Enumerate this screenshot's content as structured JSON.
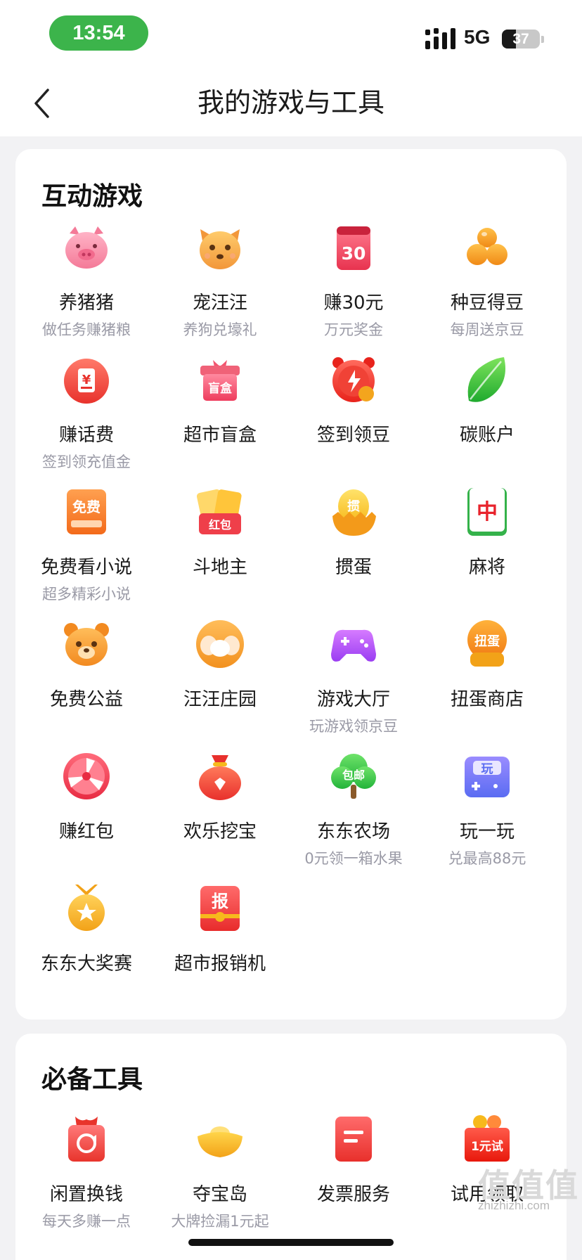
{
  "status_bar": {
    "time": "13:54",
    "network": "5G",
    "battery": "37",
    "battery_level": 0.37
  },
  "nav": {
    "title": "我的游戏与工具"
  },
  "games": {
    "title": "互动游戏",
    "items": [
      {
        "label": "养猪猪",
        "sub": "做任务赚猪粮",
        "icon": "pig-icon"
      },
      {
        "label": "宠汪汪",
        "sub": "养狗兑壕礼",
        "icon": "dog-icon"
      },
      {
        "label": "赚30元",
        "sub": "万元奖金",
        "icon": "calendar-30-icon",
        "icon_text": "30"
      },
      {
        "label": "种豆得豆",
        "sub": "每周送京豆",
        "icon": "beans-icon"
      },
      {
        "label": "赚话费",
        "sub": "签到领充值金",
        "icon": "yuan-coin-icon",
        "icon_text": "¥"
      },
      {
        "label": "超市盲盒",
        "sub": "",
        "icon": "gift-box-icon",
        "icon_text": "盲盒"
      },
      {
        "label": "签到领豆",
        "sub": "",
        "icon": "alarm-clock-icon"
      },
      {
        "label": "碳账户",
        "sub": "",
        "icon": "leaf-icon"
      },
      {
        "label": "免费看小说",
        "sub": "超多精彩小说",
        "icon": "book-icon",
        "icon_text": "免费"
      },
      {
        "label": "斗地主",
        "sub": "",
        "icon": "cards-icon",
        "icon_text": "红包"
      },
      {
        "label": "掼蛋",
        "sub": "",
        "icon": "egg-icon",
        "icon_text": "掼"
      },
      {
        "label": "麻将",
        "sub": "",
        "icon": "mahjong-tile-icon",
        "icon_text": "中"
      },
      {
        "label": "免费公益",
        "sub": "",
        "icon": "bear-icon"
      },
      {
        "label": "汪汪庄园",
        "sub": "",
        "icon": "puppy-face-icon"
      },
      {
        "label": "游戏大厅",
        "sub": "玩游戏领京豆",
        "icon": "gamepad-icon"
      },
      {
        "label": "扭蛋商店",
        "sub": "",
        "icon": "capsule-machine-icon",
        "icon_text": "扭蛋"
      },
      {
        "label": "赚红包",
        "sub": "",
        "icon": "wheel-icon"
      },
      {
        "label": "欢乐挖宝",
        "sub": "",
        "icon": "treasure-bag-icon"
      },
      {
        "label": "东东农场",
        "sub": "0元领一箱水果",
        "icon": "tree-icon",
        "icon_text": "包邮"
      },
      {
        "label": "玩一玩",
        "sub": "兑最高88元",
        "icon": "play-ticket-icon",
        "icon_text": "玩"
      },
      {
        "label": "东东大奖赛",
        "sub": "",
        "icon": "medal-icon"
      },
      {
        "label": "超市报销机",
        "sub": "",
        "icon": "receipt-icon",
        "icon_text": "报"
      }
    ]
  },
  "tools": {
    "title": "必备工具",
    "items": [
      {
        "label": "闲置换钱",
        "sub": "每天多赚一点",
        "icon": "recycle-box-icon"
      },
      {
        "label": "夺宝岛",
        "sub": "大牌捡漏1元起",
        "icon": "gold-ingot-icon"
      },
      {
        "label": "发票服务",
        "sub": "",
        "icon": "invoice-icon"
      },
      {
        "label": "试用领取",
        "sub": "",
        "icon": "trial-bag-icon",
        "icon_text": "1元试"
      }
    ]
  },
  "watermark": {
    "text": "zhizhizhi.com",
    "glyph": "值值值"
  }
}
